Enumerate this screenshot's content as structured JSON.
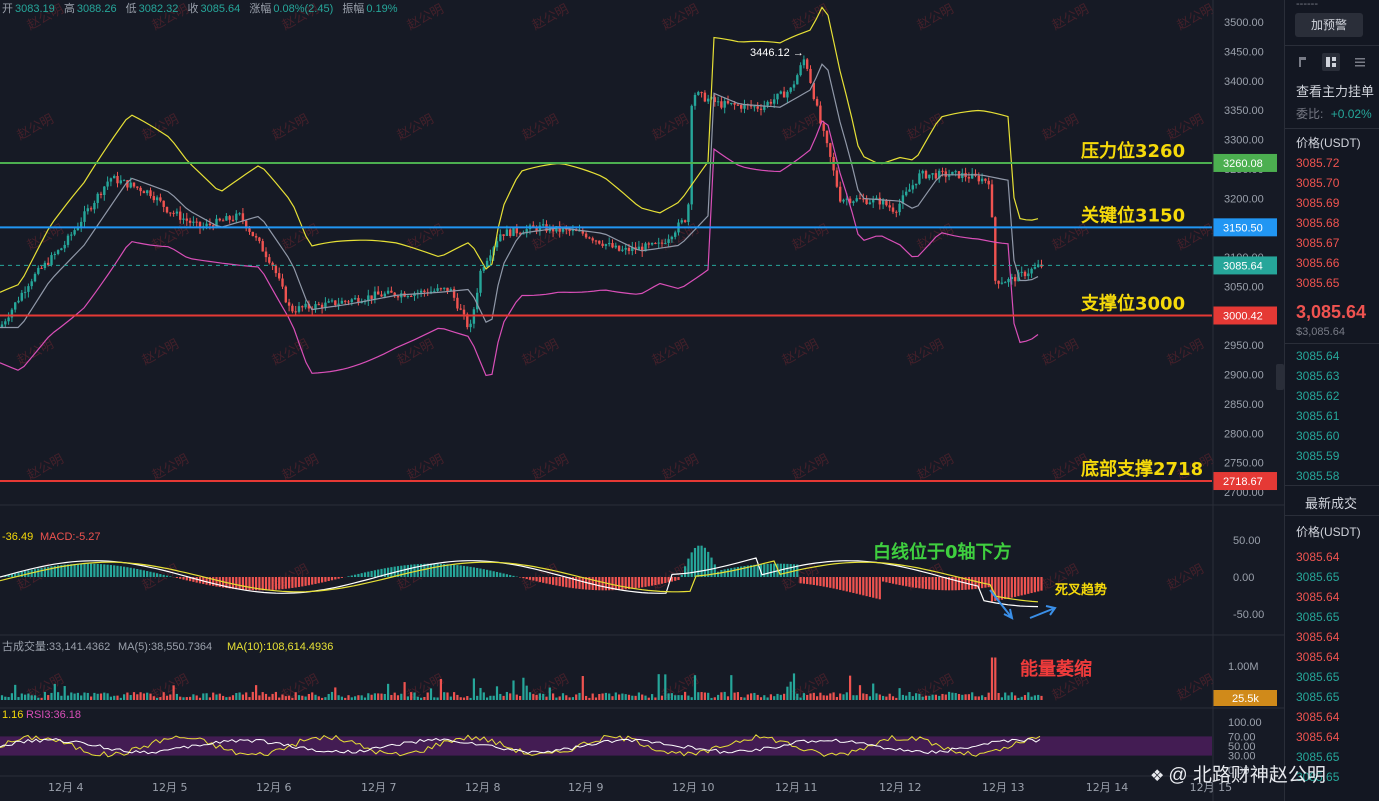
{
  "header": {
    "open_label": "开",
    "open": "3083.19",
    "high_label": "高",
    "high": "3088.26",
    "low_label": "低",
    "low": "3082.32",
    "close_label": "收",
    "close": "3085.64",
    "change_label": "涨幅",
    "change": "0.08%(2.45)",
    "amplitude_label": "振幅",
    "amplitude": "0.19%"
  },
  "annotations": {
    "resistance": "压力位3260",
    "key": "关键位3150",
    "support": "支撑位3000",
    "bottom": "底部支撑2718",
    "macd_note": "白线位于0轴下方",
    "death_cross": "死叉趋势",
    "volume_note": "能量萎缩",
    "peak_label": "3446.12 →"
  },
  "price_tags": [
    {
      "value": "3260.08",
      "color": "#4caf50"
    },
    {
      "value": "3150.50",
      "color": "#2196f3"
    },
    {
      "value": "3085.64",
      "color": "#26a69a"
    },
    {
      "value": "3000.42",
      "color": "#e53935"
    },
    {
      "value": "2718.67",
      "color": "#e53935"
    }
  ],
  "price_axis_ticks": [
    "3500.00",
    "3450.00",
    "3400.00",
    "3350.00",
    "3300.00",
    "3250.00",
    "3200.00",
    "3150.00",
    "3100.00",
    "3050.00",
    "3000.00",
    "2950.00",
    "2900.00",
    "2850.00",
    "2800.00",
    "2750.00",
    "2700.00"
  ],
  "macd": {
    "label_dif": "-36.49",
    "label_macd": "MACD:-5.27",
    "ticks": [
      "50.00",
      "0.00",
      "-50.00"
    ]
  },
  "volume": {
    "label_prefix": "古成交量:33,141.4362",
    "ma5": "MA(5):38,550.7364",
    "ma10": "MA(10):108,614.4936",
    "tick": "1.00M",
    "current_tag": "25.5k"
  },
  "rsi": {
    "label_a": "1.16",
    "label_b": "RSI3:36.18",
    "ticks": [
      "100.00",
      "70.00",
      "50.00",
      "30.00",
      "0.00"
    ]
  },
  "x_axis": [
    "12月 4",
    "12月 5",
    "12月 6",
    "12月 7",
    "12月 8",
    "12月 9",
    "12月 10",
    "12月 11",
    "12月 12",
    "12月 13",
    "12月 14",
    "12月 15"
  ],
  "watermark_text": "赵公明",
  "credit": "@ 北路财神赵公明",
  "side": {
    "alert_button": "加预警",
    "top_dashes": "------",
    "title": "查看主力挂单",
    "ratio_label": "委比:",
    "ratio_value": "+0.02%",
    "price_header": "价格(USDT)",
    "asks": [
      "3085.72",
      "3085.70",
      "3085.69",
      "3085.68",
      "3085.67",
      "3085.66",
      "3085.65"
    ],
    "big_price": "3,085.64",
    "sub_price": "$3,085.64",
    "bids": [
      "3085.64",
      "3085.63",
      "3085.62",
      "3085.61",
      "3085.60",
      "3085.59",
      "3085.58"
    ],
    "trades_title": "最新成交",
    "trades_header": "价格(USDT)",
    "trades": [
      {
        "p": "3085.64",
        "c": "red"
      },
      {
        "p": "3085.65",
        "c": "green"
      },
      {
        "p": "3085.64",
        "c": "red"
      },
      {
        "p": "3085.65",
        "c": "green"
      },
      {
        "p": "3085.64",
        "c": "red"
      },
      {
        "p": "3085.64",
        "c": "red"
      },
      {
        "p": "3085.65",
        "c": "green"
      },
      {
        "p": "3085.65",
        "c": "green"
      },
      {
        "p": "3085.64",
        "c": "red"
      },
      {
        "p": "3085.64",
        "c": "red"
      },
      {
        "p": "3085.65",
        "c": "green"
      },
      {
        "p": "3085.65",
        "c": "green"
      }
    ]
  },
  "chart_data": {
    "type": "candlestick",
    "symbol_ohlc": {
      "open": 3083.19,
      "high": 3088.26,
      "low": 3082.32,
      "close": 3085.64
    },
    "ylim": [
      2700,
      3500
    ],
    "horizontal_levels": [
      {
        "name": "压力位3260",
        "value": 3260.08,
        "color": "#4caf50"
      },
      {
        "name": "关键位3150",
        "value": 3150.5,
        "color": "#2196f3"
      },
      {
        "name": "支撑位3000",
        "value": 3000.42,
        "color": "#e53935"
      },
      {
        "name": "底部支撑2718",
        "value": 2718.67,
        "color": "#e53935"
      },
      {
        "name": "last",
        "value": 3085.64,
        "color": "#26a69a"
      }
    ],
    "categories": [
      "12月 4",
      "12月 5",
      "12月 6",
      "12月 7",
      "12月 8",
      "12月 9",
      "12月 10",
      "12月 11",
      "12月 12",
      "12月 13"
    ],
    "daily_close_approx": [
      3230,
      3160,
      3020,
      3045,
      3070,
      3110,
      3380,
      3350,
      3240,
      3085
    ],
    "peak": 3446.12
  }
}
